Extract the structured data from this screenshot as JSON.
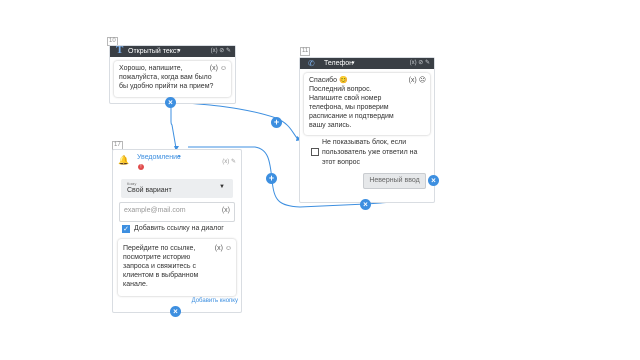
{
  "block10": {
    "number": "10",
    "type_title": "Открытый текст",
    "icon_letter": "T",
    "controls": "(x)  ⊘  ✎",
    "message": [
      "Хорошо, напишите,",
      "пожалуйста, когда вам было",
      "бы удобно прийти на прием?"
    ],
    "var_label": "(x)"
  },
  "block11": {
    "number": "11",
    "type_title": "Телефон",
    "controls": "(x)  ⊘  ✎",
    "message": [
      "Спасибо 😊",
      "Последний вопрос.",
      "Напишите свой номер",
      "телефона, мы проверим",
      "расписание и подтвердим",
      "вашу запись."
    ],
    "var_label": "(x)",
    "skip_checkbox": [
      "Не показывать блок, если",
      "пользователь уже ответил на",
      "этот вопрос"
    ],
    "invalid_button": "Неверный ввод"
  },
  "block17": {
    "number": "17",
    "type_title": "Уведомление",
    "badge": "!",
    "controls": "(x)  ✎",
    "recipient_label": "Кому",
    "recipient_value": "Свой вариант",
    "email_placeholder": "example@mail.com",
    "email_var": "(x)",
    "add_link_label": "Добавить ссылку на диалог",
    "message": [
      "Перейдите по ссылке,",
      "посмотрите историю",
      "запроса и свяжитесь с",
      "клиентом в выбранном",
      "канале."
    ],
    "var_label": "(x)",
    "add_button": "Добавить кнопку"
  },
  "colors": {
    "accent": "#3d8fe0",
    "header": "#3a3f45"
  }
}
